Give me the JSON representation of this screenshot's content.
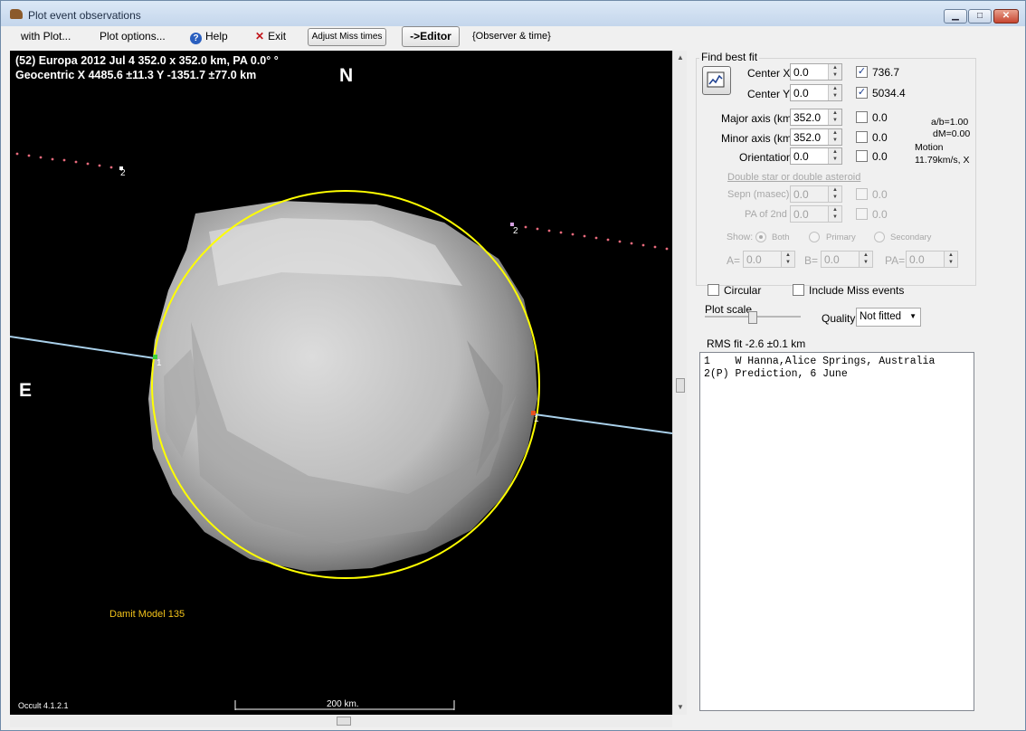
{
  "window": {
    "title": "Plot event observations",
    "buttons": {
      "minimize": "▁",
      "maximize": "□",
      "close": "✕"
    }
  },
  "menu": {
    "with_plot": "with Plot...",
    "plot_options": "Plot options...",
    "help": "Help",
    "exit": "Exit",
    "adjust_miss_times": "Adjust Miss times",
    "editor": "->Editor",
    "observer_time": "{Observer & time}"
  },
  "plot": {
    "header_line1": "(52) Europa  2012 Jul 4   352.0 x 352.0 km, PA 0.0° °",
    "header_line2": "Geocentric X 4485.6 ±11.3  Y -1351.7 ±77.0 km",
    "north_label": "N",
    "east_label": "E",
    "model_label": "Damit Model 135",
    "version": "Occult 4.1.2.1",
    "scale_label": "200 km.",
    "chord_labels": {
      "c1_left": "1",
      "c1_right": "1",
      "c2_left": "2",
      "c2_right": "2"
    },
    "colors": {
      "background": "#000000",
      "fit_ellipse": "#ffff00",
      "chord": "#a9d0ea",
      "prediction": "#e86a7c",
      "model_label": "#f2c21a"
    }
  },
  "panel": {
    "find_best_fit": "Find best fit",
    "center_x": {
      "label": "Center X",
      "value": "0.0",
      "checked": true,
      "result": "736.7"
    },
    "center_y": {
      "label": "Center Y",
      "value": "0.0",
      "checked": true,
      "result": "5034.4"
    },
    "major_axis": {
      "label": "Major axis (km)",
      "value": "352.0",
      "checked": false,
      "result": "0.0"
    },
    "minor_axis": {
      "label": "Minor axis (km)",
      "value": "352.0",
      "checked": false,
      "result": "0.0"
    },
    "orientation": {
      "label": "Orientation",
      "value": "0.0",
      "checked": false,
      "result": "0.0"
    },
    "ab_ratio": "a/b=1.00",
    "dm": "dM=0.00",
    "motion_label": "Motion",
    "motion_value": "11.79km/s, X",
    "double_star_link": "Double star  or  double asteroid",
    "sepn": {
      "label": "Sepn (masec)",
      "value": "0.0",
      "result": "0.0"
    },
    "pa_2nd": {
      "label": "PA of 2nd",
      "value": "0.0",
      "result": "0.0"
    },
    "show_label": "Show:",
    "show_options": [
      "Both",
      "Primary",
      "Secondary"
    ],
    "a_label": "A=",
    "a_value": "0.0",
    "b_label": "B=",
    "b_value": "0.0",
    "pa_label": "PA=",
    "pa_value": "0.0",
    "circular_label": "Circular",
    "include_miss_label": "Include Miss events",
    "plot_scale_label": "Plot scale",
    "quality_label": "Quality",
    "quality_value": "Not fitted",
    "rms_fit": "RMS fit -2.6 ±0.1 km",
    "observers": [
      "1    W Hanna,Alice Springs, Australia",
      "2(P) Prediction, 6 June"
    ]
  }
}
